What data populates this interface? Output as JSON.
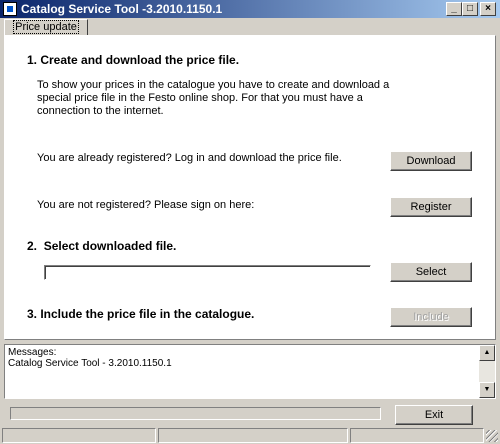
{
  "window": {
    "title": "Catalog Service Tool -3.2010.1150.1",
    "controls": {
      "minimize": "_",
      "maximize": "□",
      "close": "×"
    }
  },
  "tab": {
    "label": "Price update"
  },
  "section1": {
    "heading": "1. Create and download the price file.",
    "description_lines": [
      "To show your prices in the catalogue you have to create and download a",
      "special price file in the Festo online shop. For that you must have a",
      "connection to the internet."
    ],
    "registered_text": "You are already registered? Log in and download the price file.",
    "download_button": "Download",
    "not_registered_text": "You are not registered? Please sign on here:",
    "register_button": "Register"
  },
  "section2": {
    "number": "2.",
    "heading": "Select downloaded file.",
    "file_path_value": "",
    "select_button": "Select"
  },
  "section3": {
    "heading": "3. Include the price file in the catalogue.",
    "include_button": "Include",
    "include_enabled": false
  },
  "messages": {
    "lines": [
      "Messages:",
      "Catalog Service Tool - 3.2010.1150.1"
    ]
  },
  "footer": {
    "exit_button": "Exit",
    "progress": 0
  }
}
